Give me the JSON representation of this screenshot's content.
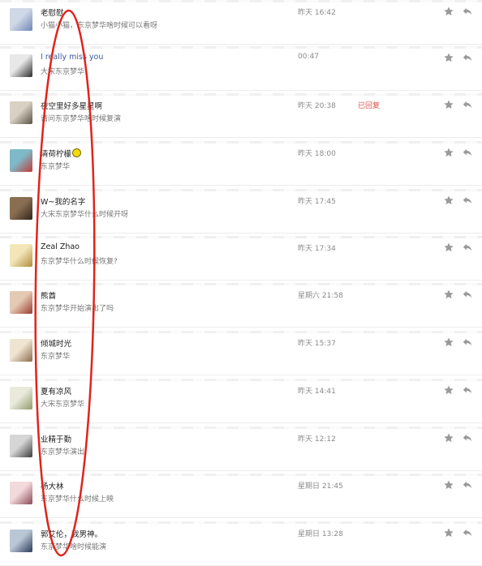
{
  "messages": [
    {
      "name": "老慰慰",
      "preview": "小猫小猫，东京梦华啥时候可以看呀",
      "time": "昨天 16:42",
      "status": "",
      "link": false,
      "emoji": false,
      "avatar_colors": [
        "#cfd8e6",
        "#6e86b6"
      ]
    },
    {
      "name": "I really miss you",
      "preview": "大宋东京梦华",
      "time": "00:47",
      "status": "",
      "link": true,
      "emoji": false,
      "avatar_colors": [
        "#e8e8e8",
        "#2a2a2a"
      ]
    },
    {
      "name": "夜空里好多星星啊",
      "preview": "请问东京梦华啥时候复演",
      "time": "昨天 20:38",
      "status": "已回复",
      "link": false,
      "emoji": false,
      "avatar_colors": [
        "#d9d2c4",
        "#5b5242"
      ]
    },
    {
      "name": "清荷柠檬",
      "preview": "东京梦华",
      "time": "昨天 18:00",
      "status": "",
      "link": false,
      "emoji": true,
      "avatar_colors": [
        "#7fb9c7",
        "#c23a3a"
      ]
    },
    {
      "name": "W~我的名字",
      "preview": "大宋东京梦华什么时候开呀",
      "time": "昨天 17:45",
      "status": "",
      "link": false,
      "emoji": false,
      "avatar_colors": [
        "#8a6e52",
        "#2e241a"
      ]
    },
    {
      "name": "Zeal Zhao",
      "preview": "东京梦华什么时候恢复?",
      "time": "昨天 17:34",
      "status": "",
      "link": false,
      "emoji": false,
      "avatar_colors": [
        "#f2e6b8",
        "#b08a3a"
      ]
    },
    {
      "name": "熊酋",
      "preview": "东京梦华开始演出了吗",
      "time": "星期六 21:58",
      "status": "",
      "link": false,
      "emoji": false,
      "avatar_colors": [
        "#e4c9b3",
        "#9a3a30"
      ]
    },
    {
      "name": "倾城时光",
      "preview": "东京梦华",
      "time": "昨天 15:37",
      "status": "",
      "link": false,
      "emoji": false,
      "avatar_colors": [
        "#efe4d2",
        "#8a6a4a"
      ]
    },
    {
      "name": "夏有凉风",
      "preview": "大宋东京梦华",
      "time": "昨天 14:41",
      "status": "",
      "link": false,
      "emoji": false,
      "avatar_colors": [
        "#e9eadb",
        "#8f9a6a"
      ]
    },
    {
      "name": "业精于勤",
      "preview": "东京梦华演出",
      "time": "昨天 12:12",
      "status": "",
      "link": false,
      "emoji": false,
      "avatar_colors": [
        "#d6d6d6",
        "#3b3b3b"
      ]
    },
    {
      "name": "杨大林",
      "preview": "东京梦华什么时候上映",
      "time": "星期日 21:45",
      "status": "",
      "link": false,
      "emoji": false,
      "avatar_colors": [
        "#f2d9dc",
        "#8a4a56"
      ]
    },
    {
      "name": "郭艾伦，我男神。",
      "preview": "东京梦华啥时候能演",
      "time": "星期日 13:28",
      "status": "",
      "link": false,
      "emoji": false,
      "avatar_colors": [
        "#b9c6d6",
        "#2a3b5a"
      ]
    }
  ],
  "icons": {
    "star": "star-icon",
    "reply": "reply-icon"
  },
  "colors": {
    "annotation": "#e0241b",
    "status": "#e2504a",
    "link": "#3a5a9a"
  }
}
